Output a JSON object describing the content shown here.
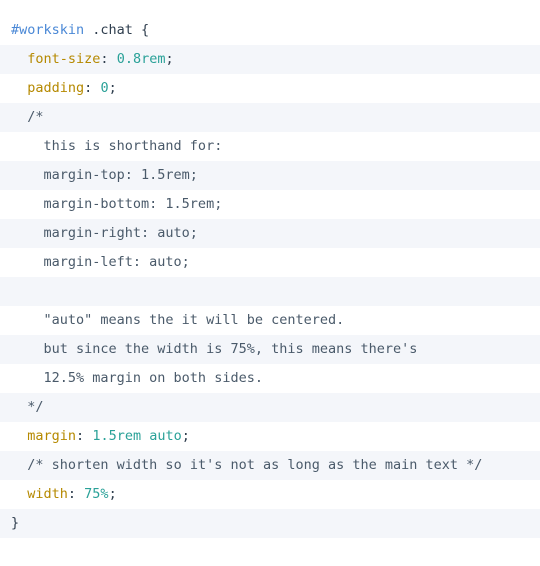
{
  "code_block": {
    "language": "css",
    "colors": {
      "background": "#ffffff",
      "stripe_background": "#f4f6fa",
      "selector_id": "#4a88d6",
      "property": "#b58900",
      "value": "#2aa198",
      "comment": "#4a5a6a",
      "punctuation": "#2f3e4e"
    },
    "lines": [
      {
        "index": 1,
        "striped": false,
        "text": "#workskin .chat {",
        "tokens": [
          {
            "kind": "selector-id",
            "text": "#workskin"
          },
          {
            "kind": "plain",
            "text": " .chat {"
          }
        ]
      },
      {
        "index": 2,
        "striped": true,
        "text": "  font-size: 0.8rem;",
        "tokens": [
          {
            "kind": "plain",
            "text": "  "
          },
          {
            "kind": "prop",
            "text": "font-size"
          },
          {
            "kind": "punct",
            "text": ": "
          },
          {
            "kind": "value",
            "text": "0.8rem"
          },
          {
            "kind": "punct",
            "text": ";"
          }
        ]
      },
      {
        "index": 3,
        "striped": false,
        "text": "  padding: 0;",
        "tokens": [
          {
            "kind": "plain",
            "text": "  "
          },
          {
            "kind": "prop",
            "text": "padding"
          },
          {
            "kind": "punct",
            "text": ": "
          },
          {
            "kind": "value",
            "text": "0"
          },
          {
            "kind": "punct",
            "text": ";"
          }
        ]
      },
      {
        "index": 4,
        "striped": true,
        "text": "  /*",
        "tokens": [
          {
            "kind": "plain",
            "text": "  "
          },
          {
            "kind": "comment",
            "text": "/*"
          }
        ]
      },
      {
        "index": 5,
        "striped": false,
        "text": "    this is shorthand for:",
        "tokens": [
          {
            "kind": "comment",
            "text": "    this is shorthand for:"
          }
        ]
      },
      {
        "index": 6,
        "striped": true,
        "text": "    margin-top: 1.5rem;",
        "tokens": [
          {
            "kind": "comment",
            "text": "    margin-top: 1.5rem;"
          }
        ]
      },
      {
        "index": 7,
        "striped": false,
        "text": "    margin-bottom: 1.5rem;",
        "tokens": [
          {
            "kind": "comment",
            "text": "    margin-bottom: 1.5rem;"
          }
        ]
      },
      {
        "index": 8,
        "striped": true,
        "text": "    margin-right: auto;",
        "tokens": [
          {
            "kind": "comment",
            "text": "    margin-right: auto;"
          }
        ]
      },
      {
        "index": 9,
        "striped": false,
        "text": "    margin-left: auto;",
        "tokens": [
          {
            "kind": "comment",
            "text": "    margin-left: auto;"
          }
        ]
      },
      {
        "index": 10,
        "striped": true,
        "text": "",
        "tokens": [
          {
            "kind": "comment",
            "text": ""
          }
        ]
      },
      {
        "index": 11,
        "striped": false,
        "text": "    \"auto\" means the it will be centered.",
        "tokens": [
          {
            "kind": "comment",
            "text": "    \"auto\" means the it will be centered."
          }
        ]
      },
      {
        "index": 12,
        "striped": true,
        "text": "    but since the width is 75%, this means there's",
        "tokens": [
          {
            "kind": "comment",
            "text": "    but since the width is 75%, this means there's"
          }
        ]
      },
      {
        "index": 13,
        "striped": false,
        "text": "    12.5% margin on both sides.",
        "tokens": [
          {
            "kind": "comment",
            "text": "    12.5% margin on both sides."
          }
        ]
      },
      {
        "index": 14,
        "striped": true,
        "text": "  */",
        "tokens": [
          {
            "kind": "plain",
            "text": "  "
          },
          {
            "kind": "comment",
            "text": "*/"
          }
        ]
      },
      {
        "index": 15,
        "striped": false,
        "text": "  margin: 1.5rem auto;",
        "tokens": [
          {
            "kind": "plain",
            "text": "  "
          },
          {
            "kind": "prop",
            "text": "margin"
          },
          {
            "kind": "punct",
            "text": ": "
          },
          {
            "kind": "value",
            "text": "1.5rem auto"
          },
          {
            "kind": "punct",
            "text": ";"
          }
        ]
      },
      {
        "index": 16,
        "striped": true,
        "text": "  /* shorten width so it's not as long as the main text */",
        "tokens": [
          {
            "kind": "plain",
            "text": "  "
          },
          {
            "kind": "comment",
            "text": "/* shorten width so it's not as long as the main text */"
          }
        ]
      },
      {
        "index": 17,
        "striped": false,
        "text": "  width: 75%;",
        "tokens": [
          {
            "kind": "plain",
            "text": "  "
          },
          {
            "kind": "prop",
            "text": "width"
          },
          {
            "kind": "punct",
            "text": ": "
          },
          {
            "kind": "value",
            "text": "75%"
          },
          {
            "kind": "punct",
            "text": ";"
          }
        ]
      },
      {
        "index": 18,
        "striped": true,
        "text": "}",
        "tokens": [
          {
            "kind": "plain",
            "text": "}"
          }
        ]
      }
    ]
  }
}
